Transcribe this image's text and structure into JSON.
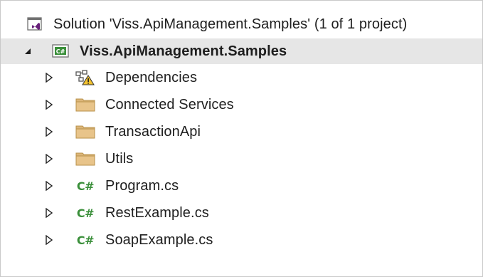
{
  "solution": {
    "label": "Solution 'Viss.ApiManagement.Samples' (1 of 1 project)",
    "icon": "visual-studio-solution-icon"
  },
  "project": {
    "label": "Viss.ApiManagement.Samples",
    "icon": "csharp-project-icon",
    "expanded": true,
    "selected": true
  },
  "items": [
    {
      "label": "Dependencies",
      "icon": "dependencies-warning-icon",
      "type": "dependencies"
    },
    {
      "label": "Connected Services",
      "icon": "folder-icon",
      "type": "folder"
    },
    {
      "label": "TransactionApi",
      "icon": "folder-icon",
      "type": "folder"
    },
    {
      "label": "Utils",
      "icon": "folder-icon",
      "type": "folder"
    },
    {
      "label": "Program.cs",
      "icon": "csharp-file-icon",
      "type": "cs"
    },
    {
      "label": "RestExample.cs",
      "icon": "csharp-file-icon",
      "type": "cs"
    },
    {
      "label": "SoapExample.cs",
      "icon": "csharp-file-icon",
      "type": "cs"
    }
  ],
  "glyphs": {
    "csharp": "C#"
  },
  "colors": {
    "selection": "#e6e6e6",
    "folder": "#dcb67a",
    "csharp": "#3a8f3a",
    "solution": "#68217a",
    "warning": "#f2c12e"
  }
}
